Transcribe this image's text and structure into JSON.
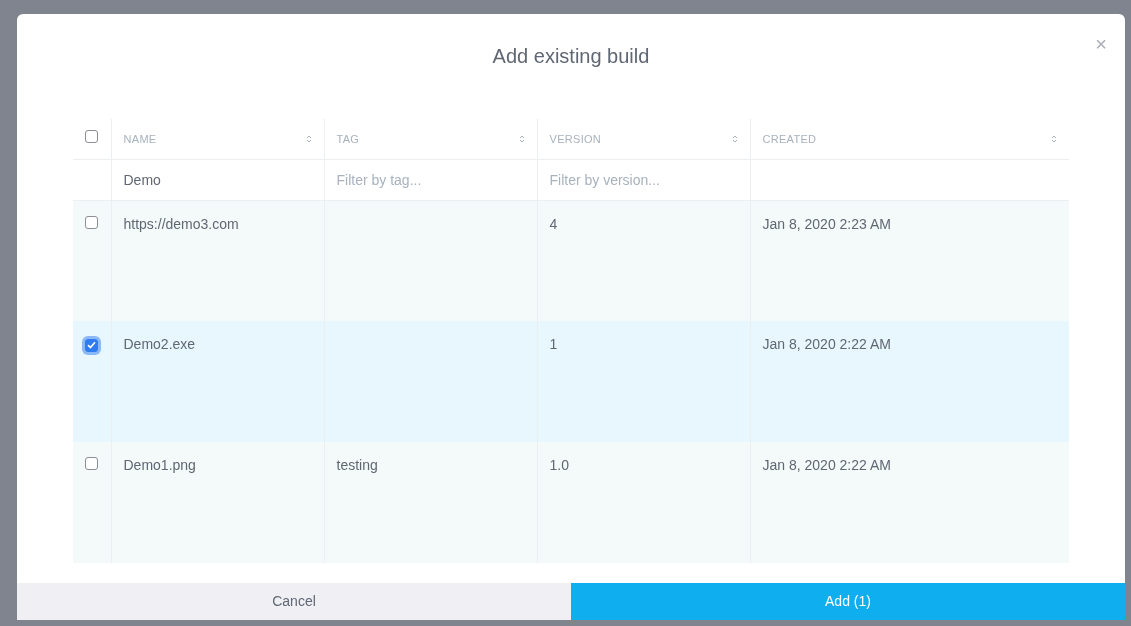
{
  "dialog": {
    "title": "Add existing build",
    "close": "×"
  },
  "table": {
    "select_all": {
      "checked": false
    },
    "columns": [
      {
        "label": "NAME"
      },
      {
        "label": "TAG"
      },
      {
        "label": "VERSION"
      },
      {
        "label": "CREATED"
      }
    ],
    "filters": [
      {
        "value": "Demo"
      },
      {
        "placeholder": "Filter by tag..."
      },
      {
        "placeholder": "Filter by version..."
      }
    ],
    "rows": [
      {
        "selected": false,
        "name": "https://demo3.com",
        "tag": "",
        "version": "4",
        "created": "Jan 8, 2020 2:23 AM"
      },
      {
        "selected": true,
        "name": "Demo2.exe",
        "tag": "",
        "version": "1",
        "created": "Jan 8, 2020 2:22 AM"
      },
      {
        "selected": false,
        "name": "Demo1.png",
        "tag": "testing",
        "version": "1.0",
        "created": "Jan 8, 2020 2:22 AM"
      }
    ]
  },
  "buttons": [
    {
      "kind": "secondary",
      "label": "Cancel"
    },
    {
      "kind": "primary",
      "label": "Add (1)"
    }
  ]
}
